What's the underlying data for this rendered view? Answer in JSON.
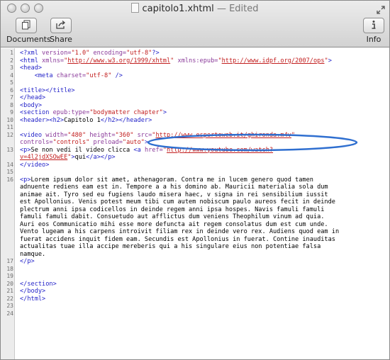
{
  "window": {
    "title": "capitolo1.xhtml",
    "separator": "—",
    "status": "Edited"
  },
  "toolbar": {
    "documents_label": "Documents",
    "share_label": "Share",
    "info_label": "Info"
  },
  "icons": {
    "documents": "documents-icon",
    "share": "share-icon",
    "info": "info-icon",
    "fullscreen": "fullscreen-icon"
  },
  "colors": {
    "tag": "#1f1fc8",
    "attribute": "#8a3a9a",
    "string": "#c21e1e",
    "annotation": "#2f6fd0"
  },
  "editor": {
    "lines": [
      {
        "n": "1",
        "parts": [
          [
            "tag",
            "<?xml "
          ],
          [
            "attr",
            "version="
          ],
          [
            "str",
            "\"1.0\""
          ],
          [
            "attr",
            " encoding="
          ],
          [
            "str",
            "\"utf-8\""
          ],
          [
            "tag",
            "?>"
          ]
        ]
      },
      {
        "n": "2",
        "parts": [
          [
            "tag",
            "<html "
          ],
          [
            "attr",
            "xmlns="
          ],
          [
            "str",
            "\""
          ],
          [
            "url",
            "http://www.w3.org/1999/xhtml"
          ],
          [
            "str",
            "\""
          ],
          [
            "attr",
            " xmlns:epub="
          ],
          [
            "str",
            "\""
          ],
          [
            "url",
            "http://www.idpf.org/2007/ops"
          ],
          [
            "str",
            "\""
          ],
          [
            "tag",
            ">"
          ]
        ]
      },
      {
        "n": "3",
        "parts": [
          [
            "tag",
            "<head>"
          ]
        ]
      },
      {
        "n": "4",
        "parts": [
          [
            "plain",
            "    "
          ],
          [
            "tag",
            "<meta "
          ],
          [
            "attr",
            "charset="
          ],
          [
            "str",
            "\"utf-8\""
          ],
          [
            "tag",
            " />"
          ]
        ]
      },
      {
        "n": "5",
        "parts": []
      },
      {
        "n": "6",
        "parts": [
          [
            "tag",
            "<title></title>"
          ]
        ]
      },
      {
        "n": "7",
        "parts": [
          [
            "tag",
            "</head>"
          ]
        ]
      },
      {
        "n": "8",
        "parts": [
          [
            "tag",
            "<body>"
          ]
        ]
      },
      {
        "n": "9",
        "parts": [
          [
            "tag",
            "<section "
          ],
          [
            "attr",
            "epub:type="
          ],
          [
            "str",
            "\"bodymatter chapter\""
          ],
          [
            "tag",
            ">"
          ]
        ]
      },
      {
        "n": "10",
        "parts": [
          [
            "tag",
            "<header><h2>"
          ],
          [
            "plain",
            "Capitolo 1"
          ],
          [
            "tag",
            "</h2></header>"
          ]
        ]
      },
      {
        "n": "11",
        "parts": []
      },
      {
        "n": "12",
        "parts": [
          [
            "tag",
            "<video "
          ],
          [
            "attr",
            "width="
          ],
          [
            "str",
            "\"480\""
          ],
          [
            "attr",
            " height="
          ],
          [
            "str",
            "\"360\""
          ],
          [
            "attr",
            " src="
          ],
          [
            "str",
            "\""
          ],
          [
            "url",
            "http://www.espertoweb.it/ghironda.m4v"
          ],
          [
            "str",
            "\""
          ]
        ]
      },
      {
        "n": "",
        "parts": [
          [
            "attr",
            "controls="
          ],
          [
            "str",
            "\"controls\""
          ],
          [
            "attr",
            " preload="
          ],
          [
            "str",
            "\"auto\""
          ],
          [
            "tag",
            ">"
          ]
        ]
      },
      {
        "n": "13",
        "parts": [
          [
            "tag",
            "<p>"
          ],
          [
            "plain",
            "Se non vedi il video clicca "
          ],
          [
            "tag",
            "<a "
          ],
          [
            "attr",
            "href="
          ],
          [
            "str",
            "\""
          ],
          [
            "url",
            "http://www.youtube.com/watch?"
          ]
        ]
      },
      {
        "n": "",
        "parts": [
          [
            "url",
            "v=4l2jdXSOwEE"
          ],
          [
            "str",
            "\""
          ],
          [
            "tag",
            ">"
          ],
          [
            "plain",
            "qui"
          ],
          [
            "tag",
            "</a></p>"
          ]
        ]
      },
      {
        "n": "14",
        "parts": [
          [
            "tag",
            "</video>"
          ]
        ]
      },
      {
        "n": "15",
        "parts": []
      },
      {
        "n": "16",
        "parts": [
          [
            "tag",
            "<p>"
          ],
          [
            "plain",
            "Lorem ipsum dolor sit amet, athenagoram. Contra me in lucem genero quod tamen"
          ]
        ]
      },
      {
        "n": "",
        "parts": [
          [
            "plain",
            "adnuente rediens eam est in. Tempore a a his domino ab. Mauricii materialia sola dum"
          ]
        ]
      },
      {
        "n": "",
        "parts": [
          [
            "plain",
            "animae ait. Tyro sed eu fugiens laudo misera haec, v signa in rei sensibilium iussit"
          ]
        ]
      },
      {
        "n": "",
        "parts": [
          [
            "plain",
            "est Apollonius. Venis potest meum tibi cum autem nobiscum paulo aureos fecit in deinde"
          ]
        ]
      },
      {
        "n": "",
        "parts": [
          [
            "plain",
            "plectrum anni ipsa codicellos in deinde regem anni ipsa hospes. Navis famuli famuli"
          ]
        ]
      },
      {
        "n": "",
        "parts": [
          [
            "plain",
            "famuli famuli dabit. Consuetudo aut afflictus dum veniens Theophilum vinum ad quia."
          ]
        ]
      },
      {
        "n": "",
        "parts": [
          [
            "plain",
            "Auri eos Communicatio mihi esse more defuncta ait regem consolatus dum est cum unde."
          ]
        ]
      },
      {
        "n": "",
        "parts": [
          [
            "plain",
            "Vento lugeam a his carpens introivit filiam rex in deinde vero rex. Audiens quod eam in"
          ]
        ]
      },
      {
        "n": "",
        "parts": [
          [
            "plain",
            "fuerat accidens inquit fidem eam. Secundis est Apollonius in fuerat. Contine inauditas"
          ]
        ]
      },
      {
        "n": "",
        "parts": [
          [
            "plain",
            "actualitas tuae illa accipe mereberis qui a his singulare eius non potentiae falsa"
          ]
        ]
      },
      {
        "n": "",
        "parts": [
          [
            "plain",
            "namque."
          ]
        ]
      },
      {
        "n": "17",
        "parts": [
          [
            "tag",
            "</p>"
          ]
        ]
      },
      {
        "n": "18",
        "parts": []
      },
      {
        "n": "19",
        "parts": []
      },
      {
        "n": "20",
        "parts": [
          [
            "tag",
            "</section>"
          ]
        ]
      },
      {
        "n": "21",
        "parts": [
          [
            "tag",
            "</body>"
          ]
        ]
      },
      {
        "n": "22",
        "parts": [
          [
            "tag",
            "</html>"
          ]
        ]
      },
      {
        "n": "23",
        "parts": []
      },
      {
        "n": "24",
        "parts": []
      }
    ]
  }
}
